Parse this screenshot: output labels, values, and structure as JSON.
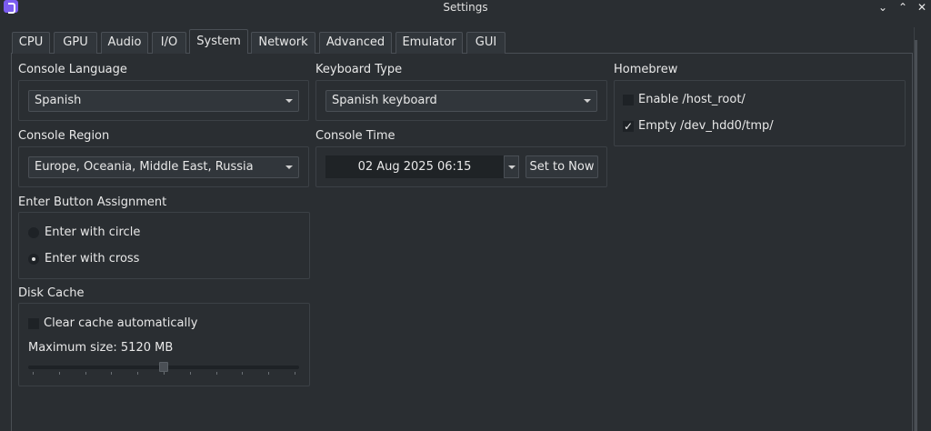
{
  "window": {
    "title": "Settings",
    "icon": "app-logo-icon"
  },
  "tabs": [
    "CPU",
    "GPU",
    "Audio",
    "I/O",
    "System",
    "Network",
    "Advanced",
    "Emulator",
    "GUI"
  ],
  "active_tab": "System",
  "console_language": {
    "label": "Console Language",
    "value": "Spanish"
  },
  "keyboard_type": {
    "label": "Keyboard Type",
    "value": "Spanish keyboard"
  },
  "homebrew": {
    "label": "Homebrew",
    "enable_host_root": {
      "label": "Enable /host_root/",
      "checked": false
    },
    "empty_dev_hdd0_tmp": {
      "label": "Empty /dev_hdd0/tmp/",
      "checked": true
    }
  },
  "console_region": {
    "label": "Console Region",
    "value": "Europe, Oceania, Middle East, Russia"
  },
  "console_time": {
    "label": "Console Time",
    "value": "02 Aug 2025 06:15",
    "set_now_label": "Set to Now"
  },
  "enter_button": {
    "label": "Enter Button Assignment",
    "options": [
      {
        "label": "Enter with circle",
        "checked": false
      },
      {
        "label": "Enter with cross",
        "checked": true
      }
    ]
  },
  "disk_cache": {
    "label": "Disk Cache",
    "clear_auto": {
      "label": "Clear cache automatically",
      "checked": false
    },
    "max_size_label": "Maximum size: 5120 MB",
    "slider_fraction": 0.5
  },
  "colors": {
    "background": "#2a2e32",
    "field": "#31363b",
    "border": "#4a4f55"
  }
}
